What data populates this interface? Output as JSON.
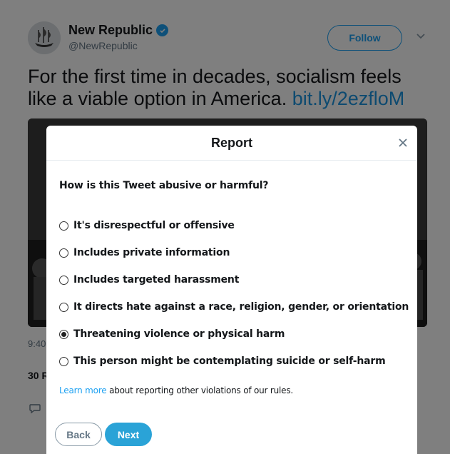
{
  "tweet": {
    "author_name": "New Republic",
    "author_handle": "@NewRepublic",
    "follow_label": "Follow",
    "text": "For the first time in decades, socialism feels like a viable option in America.",
    "link": "bit.ly/2ezfloM",
    "time_partial": "9:40",
    "retweets_partial": "30 R"
  },
  "report_dialog": {
    "title": "Report",
    "question": "How is this Tweet abusive or harmful?",
    "options": [
      {
        "label": "It's disrespectful or offensive",
        "selected": false
      },
      {
        "label": "Includes private information",
        "selected": false
      },
      {
        "label": "Includes targeted harassment",
        "selected": false
      },
      {
        "label": "It directs hate against a race, religion, gender, or orientation",
        "selected": false
      },
      {
        "label": "Threatening violence or physical harm",
        "selected": true
      },
      {
        "label": "This person might be contemplating suicide or self-harm",
        "selected": false
      }
    ],
    "learn_more_link": "Learn more",
    "learn_more_text": " about reporting other violations of our rules.",
    "back_label": "Back",
    "next_label": "Next"
  },
  "colors": {
    "accent": "#1da1f2",
    "next_button": "#2aa3d7",
    "overlay": "rgba(0,0,0,0.5)"
  }
}
